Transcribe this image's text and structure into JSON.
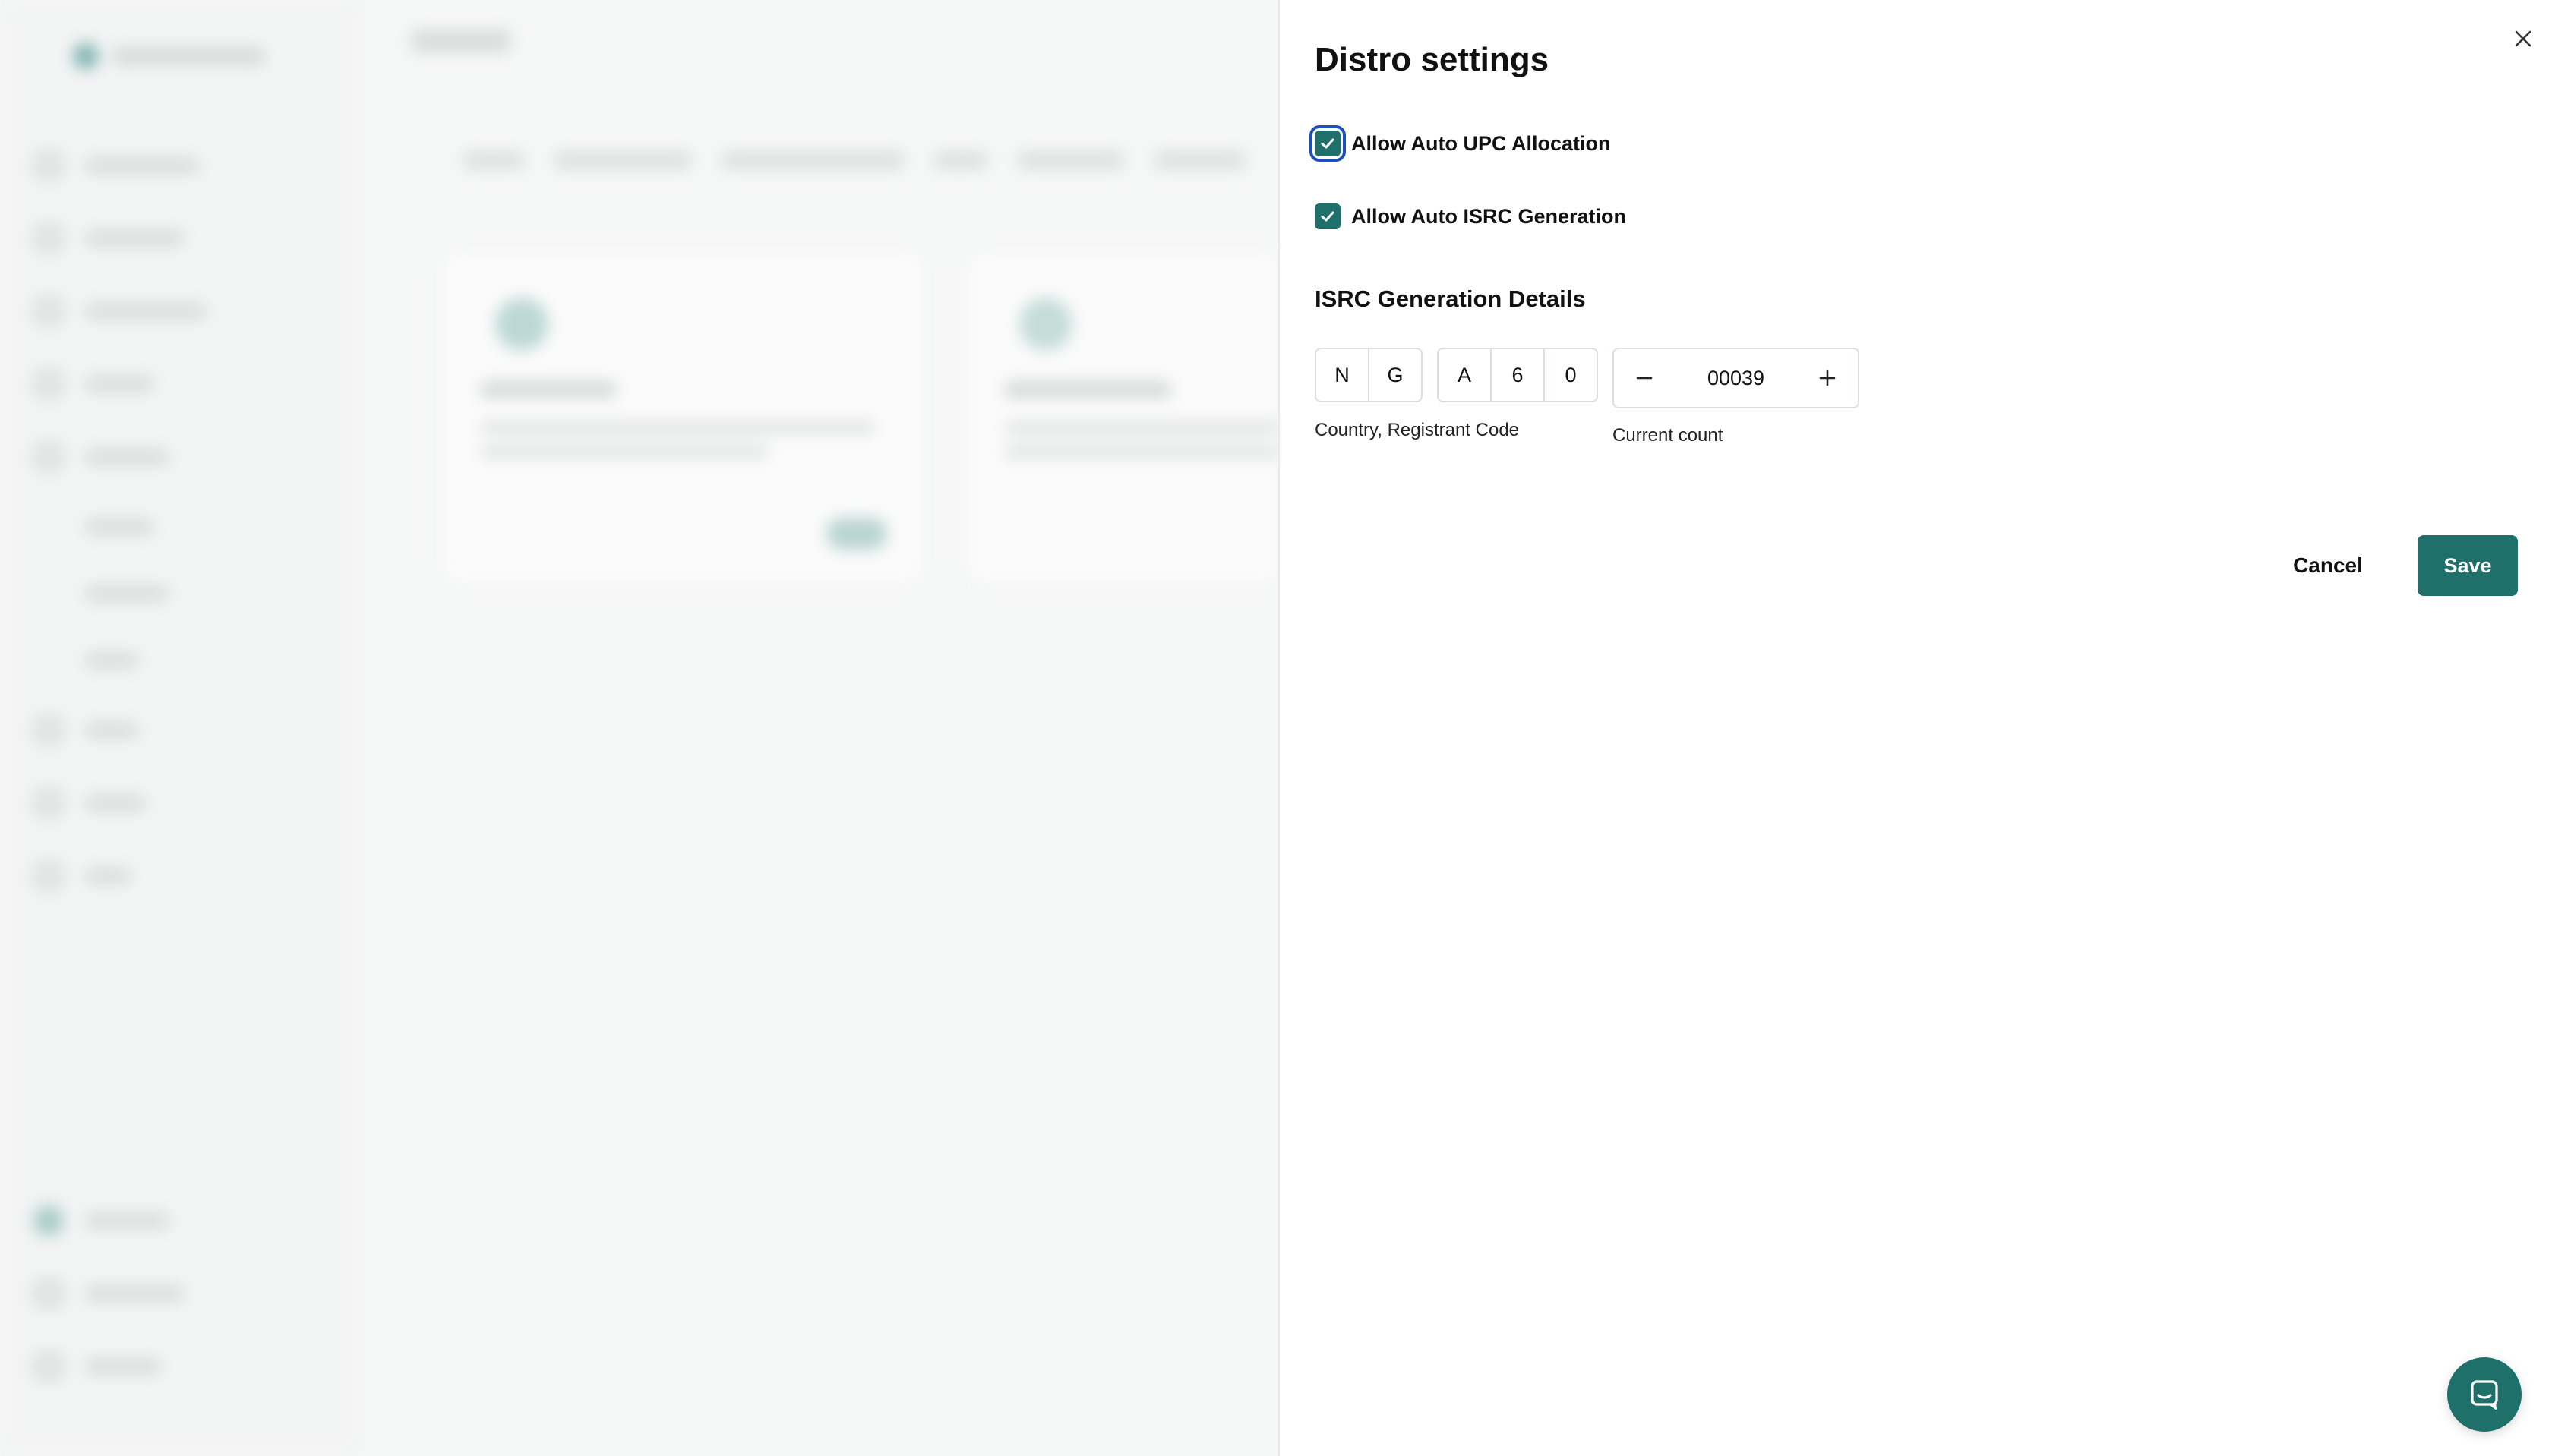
{
  "panel": {
    "title": "Distro settings",
    "options": {
      "upc": {
        "label": "Allow Auto UPC Allocation",
        "checked": true
      },
      "isrc": {
        "label": "Allow Auto ISRC Generation",
        "checked": true
      }
    },
    "isrc_section": {
      "title": "ISRC Generation Details",
      "country_code": [
        "N",
        "G"
      ],
      "registrant_code": [
        "A",
        "6",
        "0"
      ],
      "code_caption": "Country, Registrant Code",
      "current_count": "00039",
      "count_caption": "Current count"
    },
    "actions": {
      "cancel_label": "Cancel",
      "save_label": "Save"
    }
  },
  "colors": {
    "accent": "#1f6f6b",
    "focus_ring": "#1d4fb8"
  },
  "icons": {
    "close": "close-icon",
    "minus": "minus-icon",
    "plus": "plus-icon",
    "chat": "chat-icon",
    "check": "check-icon"
  }
}
